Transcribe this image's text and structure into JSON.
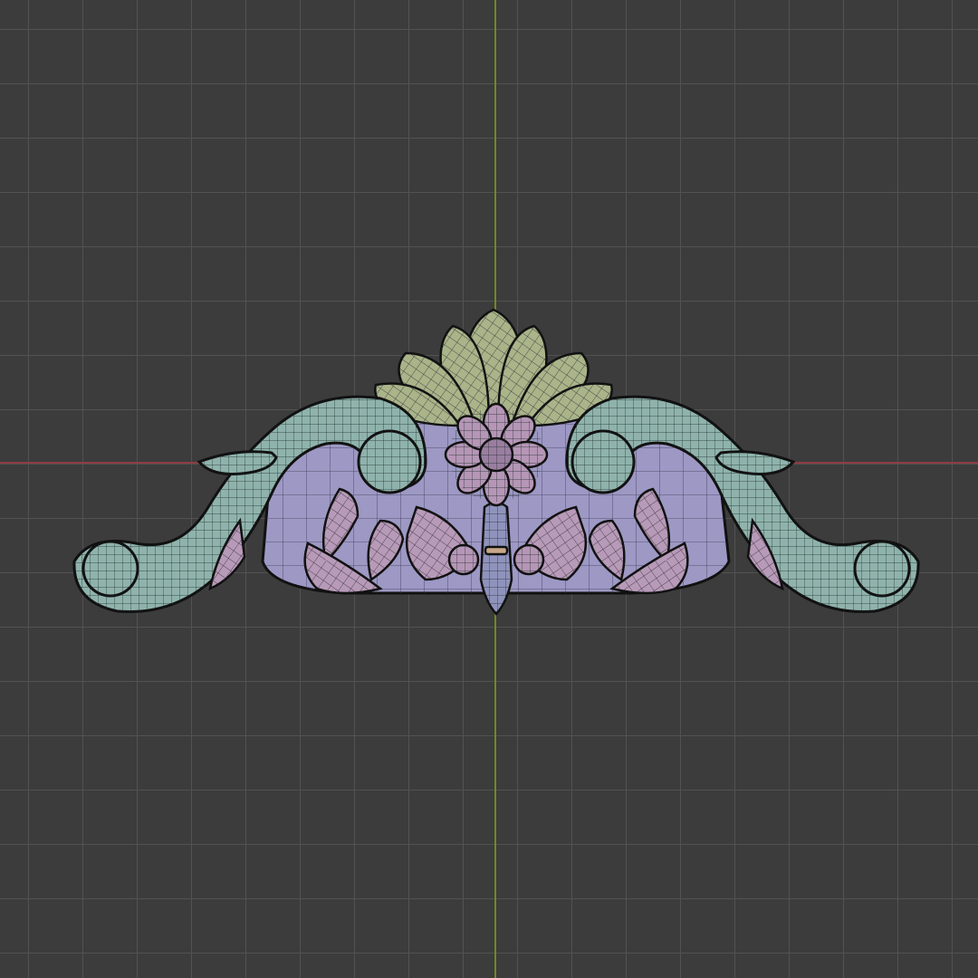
{
  "viewport": {
    "view": "3d-viewport-front-orthographic",
    "shading": "wireframe-overlay",
    "background_color": "#3c3c3c",
    "grid_color": "#525252",
    "x_axis_color": "#8e3c45",
    "y_axis_color": "#6f8a1f"
  },
  "model": {
    "name": "ornamental-carved-applique",
    "materials": {
      "scroll_leaves": "#8fb3ac",
      "palmette_fan": "#a9b489",
      "back_plate": "#9d98c4",
      "acanthus_leaves": "#b79ab8",
      "rosette": "#b596b6",
      "center_stem": "#8f93bc",
      "outline": "#111111",
      "wire": "#1d2a2a"
    }
  }
}
